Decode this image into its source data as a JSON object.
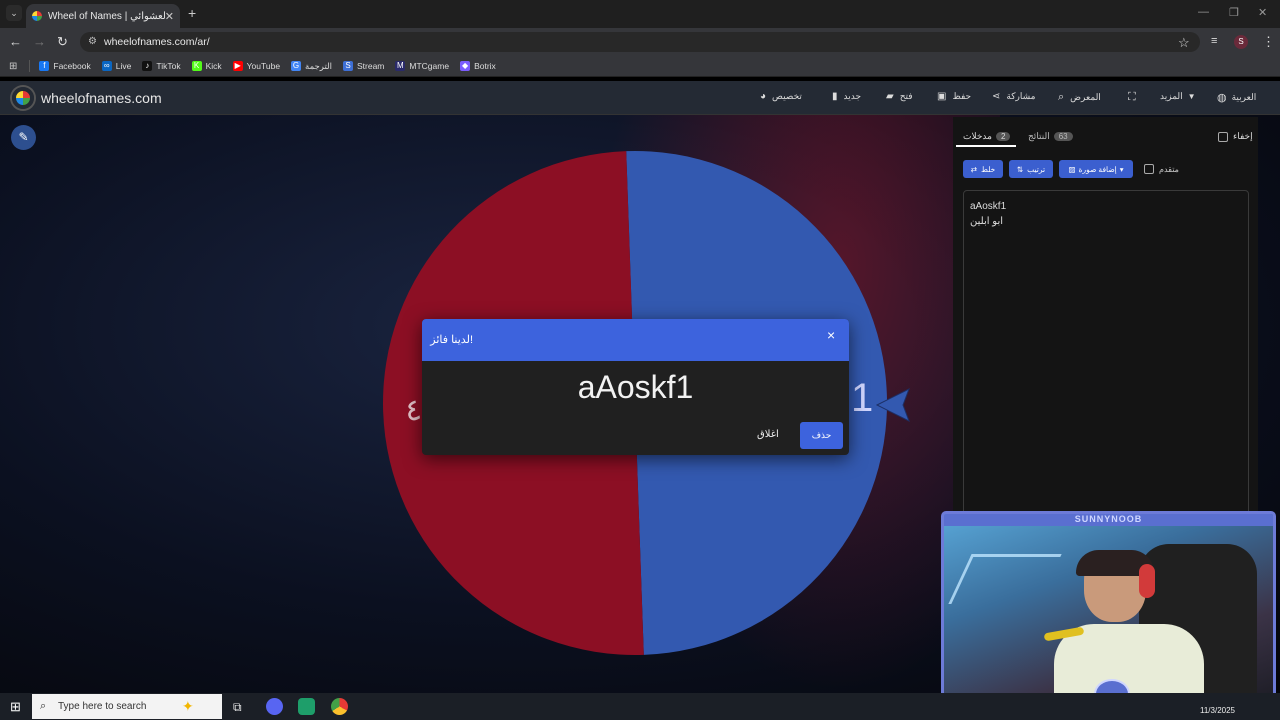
{
  "browser": {
    "tab_title": "Wheel of Names | سم العشوائي",
    "tab_close": "✕",
    "new_tab": "+",
    "url": "wheelofnames.com/ar/",
    "profile_initial": "S",
    "bookmarks": [
      {
        "label": "Facebook",
        "color": "#1877f2",
        "glyph": "f"
      },
      {
        "label": "Live",
        "color": "#0a66c2",
        "glyph": "∞"
      },
      {
        "label": "TikTok",
        "color": "#111111",
        "glyph": "♪"
      },
      {
        "label": "Kick",
        "color": "#53fc18",
        "glyph": "K"
      },
      {
        "label": "YouTube",
        "color": "#ff0000",
        "glyph": "▶"
      },
      {
        "label": "الترجمة",
        "color": "#4285f4",
        "glyph": "G"
      },
      {
        "label": "Stream",
        "color": "#3d6fd6",
        "glyph": "S"
      },
      {
        "label": "MTCgame",
        "color": "#2a2a6a",
        "glyph": "M"
      },
      {
        "label": "Botrix",
        "color": "#7b5cff",
        "glyph": "◆"
      }
    ]
  },
  "site": {
    "name": "wheelofnames.com",
    "menu": [
      {
        "label": "العربية",
        "icon": "globe-icon"
      },
      {
        "label": "المزيد",
        "icon": "chevron-down-icon"
      },
      {
        "label": "",
        "icon": "fullscreen-icon"
      },
      {
        "label": "المعرض",
        "icon": "search-icon"
      },
      {
        "label": "مشاركة",
        "icon": "share-icon"
      },
      {
        "label": "حفظ",
        "icon": "save-icon"
      },
      {
        "label": "فتح",
        "icon": "folder-icon"
      },
      {
        "label": "جديد",
        "icon": "file-icon"
      },
      {
        "label": "تخصيص",
        "icon": "palette-icon"
      }
    ]
  },
  "wheel": {
    "segments": [
      {
        "label": "aAoskf1",
        "color": "#3359b0"
      },
      {
        "label": "ابو ابلين",
        "color": "#8c0f24"
      }
    ],
    "visible_label_fragment_right": "1",
    "visible_label_fragment_left": "ا٤"
  },
  "panel": {
    "hide_label": "إخفاء",
    "tab_entries_label": "مدخلات",
    "tab_entries_count": "2",
    "tab_results_label": "النتائج",
    "tab_results_count": "63",
    "shuffle_label": "خلط",
    "sort_label": "ترتيب",
    "add_image_label": "إضافة صورة",
    "advanced_label": "متقدم",
    "entries": [
      "aAoskf1",
      "ابو ابلين"
    ]
  },
  "dialog": {
    "title": "لدينا فائز!",
    "close_x": "×",
    "winner": "aAoskf1",
    "close_label": "اغلاق",
    "remove_label": "حذف"
  },
  "webcam": {
    "banner": "SUNNYNOOB"
  },
  "taskbar": {
    "search_placeholder": "Type here to search",
    "date": "11/3/2025"
  }
}
